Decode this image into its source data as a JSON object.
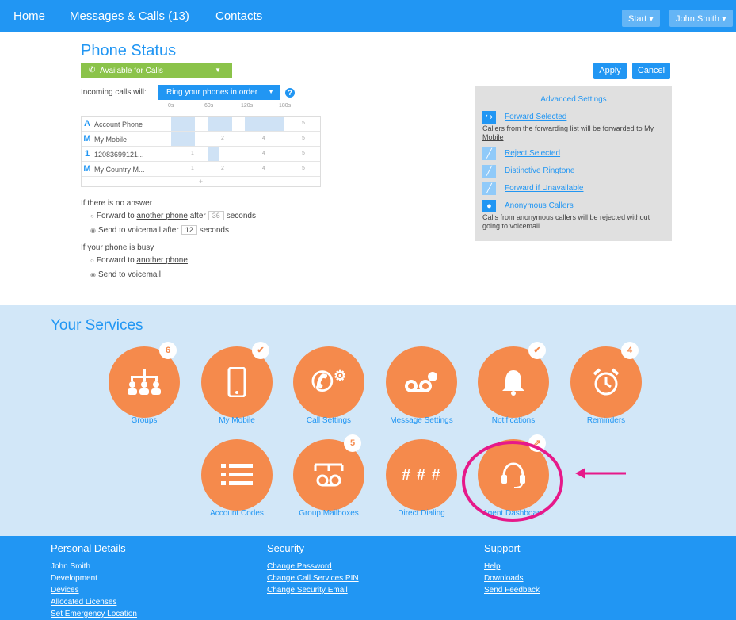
{
  "nav": {
    "home": "Home",
    "messages": "Messages & Calls (13)",
    "contacts": "Contacts",
    "start": "Start",
    "user": "John Smith"
  },
  "phone_status": {
    "title": "Phone Status",
    "availability": "Available for Calls",
    "incoming_label": "Incoming calls will:",
    "ring_mode": "Ring your phones in order",
    "timeline_ticks": [
      "0s",
      "60s",
      "120s",
      "180s"
    ],
    "phones": [
      {
        "badge": "A",
        "name": "Account Phone",
        "steps": [
          "",
          "",
          "",
          "5"
        ]
      },
      {
        "badge": "M",
        "name": "My Mobile",
        "steps": [
          "",
          "2",
          "4",
          "5"
        ]
      },
      {
        "badge": "1",
        "name": "12083699121...",
        "steps": [
          "1",
          "",
          "4",
          "5"
        ]
      },
      {
        "badge": "M",
        "name": "My Country M...",
        "steps": [
          "1",
          "2",
          "4",
          "5"
        ]
      }
    ],
    "add_row": "+",
    "no_answer": {
      "question": "If there is no answer",
      "opt1_pre": "Forward to",
      "opt1_link": "another phone",
      "opt1_mid": "after",
      "opt1_value": "36",
      "opt1_post": "seconds",
      "opt2_pre": "Send to voicemail after",
      "opt2_value": "12",
      "opt2_post": "seconds"
    },
    "busy": {
      "question": "If your phone is busy",
      "opt1_pre": "Forward to",
      "opt1_link": "another phone",
      "opt2": "Send to voicemail"
    },
    "apply": "Apply",
    "cancel": "Cancel"
  },
  "advanced": {
    "title": "Advanced Settings",
    "forward_selected": "Forward Selected",
    "forward_desc_pre": "Callers from the",
    "forward_desc_link": "forwarding list",
    "forward_desc_mid": "will be forwarded to",
    "forward_desc_target": "My Mobile",
    "reject_selected": "Reject Selected",
    "distinctive_ringtone": "Distinctive Ringtone",
    "forward_if_unavailable": "Forward if Unavailable",
    "anonymous_callers": "Anonymous Callers",
    "anonymous_desc": "Calls from anonymous callers will be rejected without going to voicemail"
  },
  "services": {
    "title": "Your Services",
    "items": [
      {
        "label": "Groups",
        "badge": "6",
        "icon": "groups-icon"
      },
      {
        "label": "My Mobile",
        "badge": "✔",
        "icon": "mobile-icon"
      },
      {
        "label": "Call Settings",
        "badge": "",
        "icon": "call-settings-icon"
      },
      {
        "label": "Message Settings",
        "badge": "",
        "icon": "voicemail-settings-icon"
      },
      {
        "label": "Notifications",
        "badge": "✔",
        "icon": "bell-icon"
      },
      {
        "label": "Reminders",
        "badge": "4",
        "icon": "alarm-clock-icon"
      },
      {
        "label": "Account Codes",
        "badge": "",
        "icon": "list-icon"
      },
      {
        "label": "Group Mailboxes",
        "badge": "5",
        "icon": "group-voicemail-icon"
      },
      {
        "label": "Direct Dialing",
        "badge": "",
        "icon": "hash-icon",
        "glyph": "# # #"
      },
      {
        "label": "Agent Dashboard",
        "badge": "⇗",
        "icon": "headset-icon"
      }
    ]
  },
  "footer": {
    "personal": {
      "title": "Personal Details",
      "name": "John Smith",
      "department": "Development",
      "links": [
        "Devices",
        "Allocated Licenses",
        "Set Emergency Location"
      ]
    },
    "security": {
      "title": "Security",
      "links": [
        "Change Password",
        "Change Call Services PIN",
        "Change Security Email"
      ]
    },
    "support": {
      "title": "Support",
      "links": [
        "Help",
        "Downloads",
        "Send Feedback"
      ]
    }
  },
  "colors": {
    "primary": "#2196f3",
    "available": "#8bc34a",
    "service_orange": "#f58a4c",
    "services_bg": "#d2e7f8",
    "highlight_magenta": "#e6198a"
  }
}
